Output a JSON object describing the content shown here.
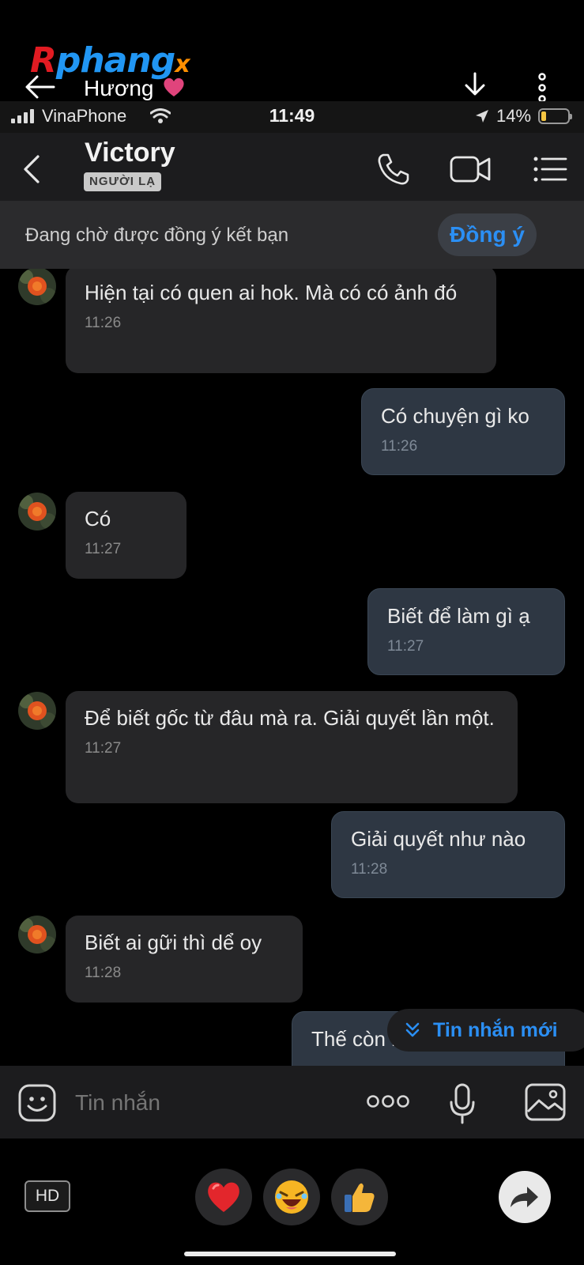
{
  "overlay": {
    "brand_part1": "R",
    "brand_part2": "phang",
    "brand_part3": "x",
    "name": "Hương"
  },
  "status_bar": {
    "carrier": "VinaPhone",
    "time": "11:49",
    "battery": "14%",
    "battery_level": 0.14
  },
  "header": {
    "contact_name": "Victory",
    "badge": "NGƯỜI LẠ"
  },
  "banner": {
    "text": "Đang chờ được đồng ý kết bạn",
    "button": "Đồng ý"
  },
  "messages": [
    {
      "side": "in",
      "text": "Hiện tại có quen ai hok. Mà có có ảnh đó",
      "time": "11:26"
    },
    {
      "side": "out",
      "text": "Có chuyện gì ko",
      "time": "11:26"
    },
    {
      "side": "in",
      "text": "Có",
      "time": "11:27"
    },
    {
      "side": "out",
      "text": "Biết để làm gì ạ",
      "time": "11:27"
    },
    {
      "side": "in",
      "text": "Để biết gốc từ đâu mà ra. Giải quyết lần một.",
      "time": "11:27"
    },
    {
      "side": "out",
      "text": "Giải quyết như nào",
      "time": "11:28"
    },
    {
      "side": "in",
      "text": "Biết ai gữi thì dể oy",
      "time": "11:28"
    },
    {
      "side": "out",
      "text": "Thế còn hình gì nữa ko",
      "time": ""
    }
  ],
  "new_message_pill": "Tin nhắn mới",
  "composer": {
    "placeholder": "Tin nhắn"
  },
  "bottom": {
    "hd_label": "HD"
  },
  "colors": {
    "accent_blue": "#2b8ff4",
    "incoming_bubble": "#262628",
    "outgoing_bubble": "#2e3743"
  }
}
